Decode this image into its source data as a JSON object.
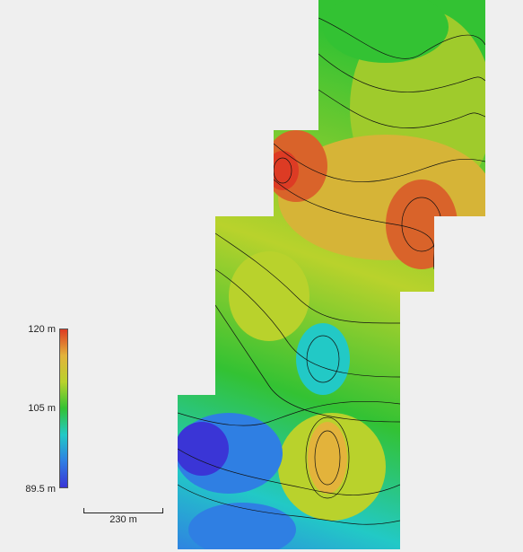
{
  "legend": {
    "title": "",
    "max_label": "120 m",
    "mid_label": "105 m",
    "min_label": "89.5 m",
    "colors": [
      "#3a35d6",
      "#2f7fe3",
      "#22c9c6",
      "#33c233",
      "#b9d22c",
      "#e3b33b",
      "#dd3b24"
    ]
  },
  "scalebar": {
    "label": "230 m"
  },
  "map": {
    "type": "elevation-contour-map",
    "contours": "black isolines",
    "peak_color": "#dd3b24",
    "valley_color": "#2a3ad6"
  }
}
